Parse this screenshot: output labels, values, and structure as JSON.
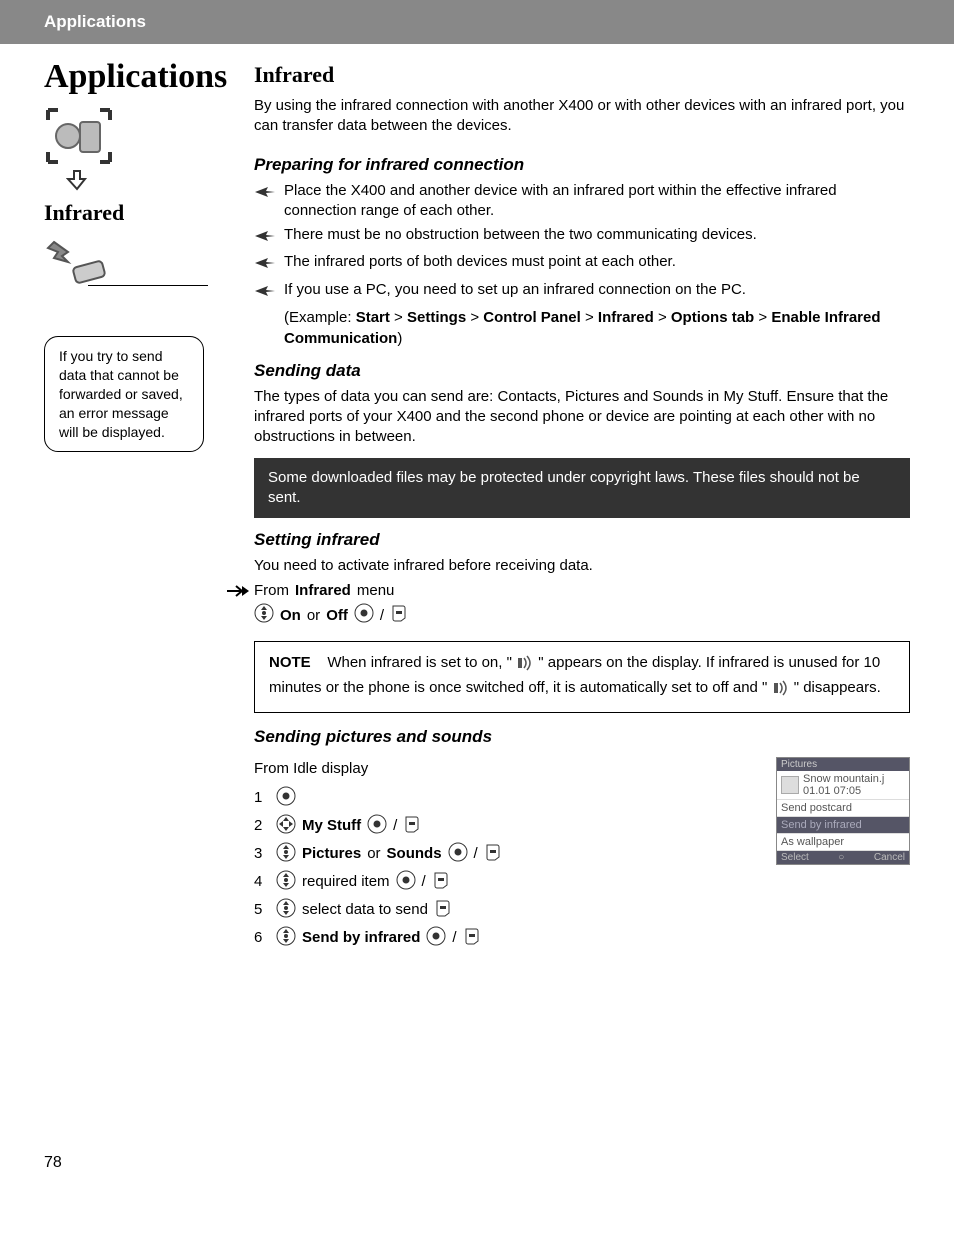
{
  "header": {
    "section": "Applications"
  },
  "sidebar": {
    "title": "Applications",
    "subtitle": "Infrared",
    "tip": "If you try to send data that cannot be forwarded or saved, an error message will be displayed."
  },
  "main": {
    "title": "Infrared",
    "intro": "By using the infrared connection with another X400 or with other devices with an infrared port, you can transfer data between the devices.",
    "prep": {
      "head": "Preparing for infrared connection",
      "b1": "Place the X400 and another device with an infrared port within the effective infrared connection range of each other.",
      "b2": "There must be no obstruction between the two communicating devices.",
      "b3": "The infrared ports of both devices must point at each other.",
      "b4": "If you use a PC, you need to set up an infrared connection on the PC.",
      "example_prefix": "(Example: ",
      "example_path": [
        "Start",
        "Settings",
        "Control Panel",
        "Infrared",
        "Options tab",
        "Enable Infrared Communication"
      ],
      "example_suffix": ")"
    },
    "sending": {
      "head": "Sending data",
      "text": "The types of data you can send are: Contacts, Pictures and Sounds in My Stuff. Ensure that the infrared ports of your X400 and the second phone or device are pointing at each other with no obstructions in between.",
      "warn": "Some downloaded files may be protected under copyright laws. These files should not be sent."
    },
    "setting": {
      "head": "Setting infrared",
      "text": "You need to activate infrared before receiving data.",
      "from_prefix": "From ",
      "from_bold": "Infrared",
      "from_suffix": " menu",
      "on": "On",
      "or": " or ",
      "off": "Off",
      "slash": " / "
    },
    "note": {
      "label": "NOTE",
      "t1": "When infrared is set to on, \" ",
      "t2": " \" appears on the display. If infrared is unused for 10 minutes or the phone is once switched off, it is automatically set to off and \" ",
      "t3": " \" disappears."
    },
    "pics": {
      "head": "Sending pictures and sounds",
      "from": "From Idle display",
      "s2": "My Stuff",
      "s3a": "Pictures",
      "s3or": " or ",
      "s3b": "Sounds",
      "s4": "required item",
      "s5": "select data to send",
      "s6": "Send by infrared",
      "slash": " / "
    }
  },
  "phone": {
    "top": "Pictures",
    "name": "Snow mountain.j",
    "date": "01.01 07:05",
    "opt1": "Send postcard",
    "opt2": "Send by infrared",
    "opt3": "As wallpaper",
    "left": "Select",
    "right": "Cancel"
  },
  "page_number": "78"
}
